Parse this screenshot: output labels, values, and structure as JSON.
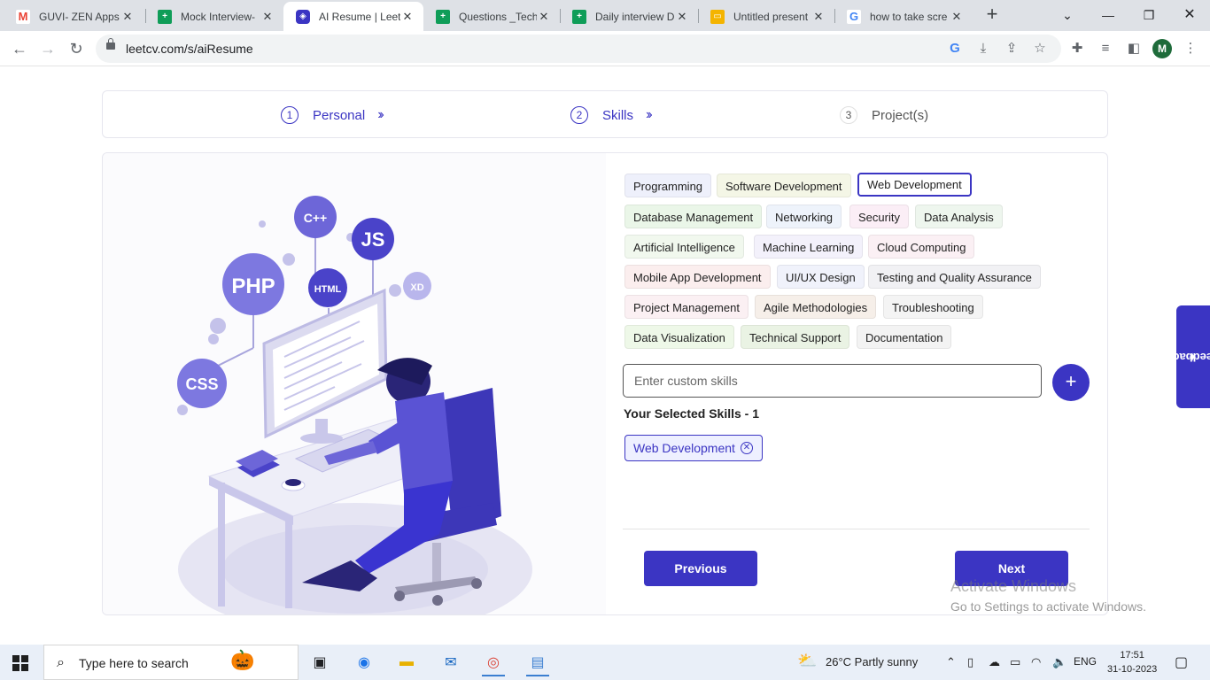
{
  "browser": {
    "tabs": [
      {
        "title": "GUVI- ZEN Apps",
        "favicon": "gmail-icon",
        "color": "#ea4335"
      },
      {
        "title": "Mock Interview-",
        "favicon": "sheets-icon",
        "color": "#0f9d58"
      },
      {
        "title": "AI Resume | Leet",
        "favicon": "leetcv-icon",
        "color": "#3b35c3"
      },
      {
        "title": "Questions _Tech",
        "favicon": "sheets-icon",
        "color": "#0f9d58"
      },
      {
        "title": "Daily interview D",
        "favicon": "sheets-icon",
        "color": "#0f9d58"
      },
      {
        "title": "Untitled present",
        "favicon": "slides-icon",
        "color": "#f4b400"
      },
      {
        "title": "how to take scre",
        "favicon": "google-icon",
        "color": "#4285f4"
      }
    ],
    "url": "leetcv.com/s/aiResume",
    "profile_initial": "M"
  },
  "stepper": {
    "steps": [
      {
        "num": "1",
        "label": "Personal"
      },
      {
        "num": "2",
        "label": "Skills"
      },
      {
        "num": "3",
        "label": "Project(s)"
      }
    ]
  },
  "illustration": {
    "badges": [
      "C++",
      "JS",
      "PHP",
      "HTML",
      "XD",
      "CSS"
    ]
  },
  "skills": {
    "chips": [
      {
        "label": "Programming",
        "color": "#eef0fb"
      },
      {
        "label": "Software Development",
        "color": "#f4f6e6"
      },
      {
        "label": "Web Development",
        "color": "#ffffff",
        "selected": true
      },
      {
        "label": "Database Management",
        "color": "#eaf6e8"
      },
      {
        "label": "Networking",
        "color": "#eef3fb"
      },
      {
        "label": "Security",
        "color": "#fbeef6"
      },
      {
        "label": "Data Analysis",
        "color": "#eef6ee"
      },
      {
        "label": "Artificial Intelligence",
        "color": "#f1f8ee"
      },
      {
        "label": "Machine Learning",
        "color": "#f3f1fb"
      },
      {
        "label": "Cloud Computing",
        "color": "#fbf0f4"
      },
      {
        "label": "Mobile App Development",
        "color": "#fbeeee"
      },
      {
        "label": "UI/UX Design",
        "color": "#f0f2fb"
      },
      {
        "label": "Testing and Quality Assurance",
        "color": "#f1f1f4"
      },
      {
        "label": "Project Management",
        "color": "#fbf0f3"
      },
      {
        "label": "Agile Methodologies",
        "color": "#f6efe9"
      },
      {
        "label": "Troubleshooting",
        "color": "#f4f4f4"
      },
      {
        "label": "Data Visualization",
        "color": "#eef8e8"
      },
      {
        "label": "Technical Support",
        "color": "#eaf3e4"
      },
      {
        "label": "Documentation",
        "color": "#f3f3f3"
      }
    ],
    "custom_placeholder": "Enter custom skills",
    "add_label": "+",
    "selected_title": "Your Selected Skills - 1",
    "selected": [
      "Web Development"
    ]
  },
  "actions": {
    "previous": "Previous",
    "next": "Next"
  },
  "feedback_label": "Feedback",
  "watermark": {
    "line1": "Activate Windows",
    "line2": "Go to Settings to activate Windows."
  },
  "taskbar": {
    "search_placeholder": "Type here to search",
    "weather": "26°C  Partly sunny",
    "language": "ENG",
    "time": "17:51",
    "date": "31-10-2023"
  },
  "theme": {
    "accent": "#3b35c3"
  }
}
